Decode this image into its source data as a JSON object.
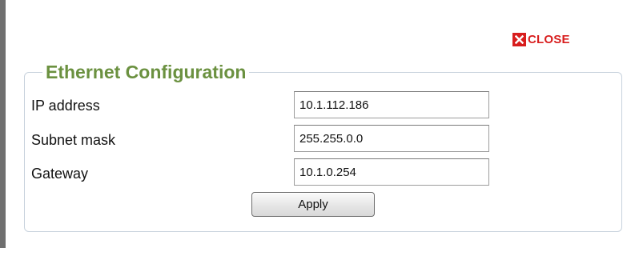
{
  "close": {
    "label": "CLOSE",
    "icon": "close-icon",
    "color": "#d81e1e"
  },
  "panel": {
    "title": "Ethernet Configuration",
    "title_color": "#6b9140",
    "fields": [
      {
        "label": "IP address",
        "value": "10.1.112.186"
      },
      {
        "label": "Subnet mask",
        "value": "255.255.0.0"
      },
      {
        "label": "Gateway",
        "value": "10.1.0.254"
      }
    ],
    "apply_label": "Apply"
  }
}
